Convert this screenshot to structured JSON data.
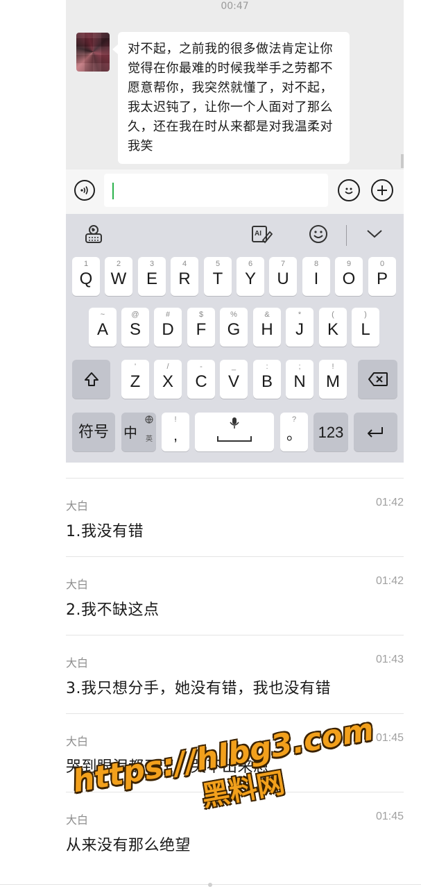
{
  "chat": {
    "timestamp": "00:47",
    "message": "对不起，之前我的很多做法肯定让你觉得在你最难的时候我举手之劳都不愿意帮你，我突然就懂了，对不起，我太迟钝了，让你一个人面对了那么久，还在我在时从来都是对我温柔对我笑"
  },
  "input_bar": {
    "voice_icon": "voice-icon",
    "emoji_icon": "emoji-icon",
    "plus_icon": "plus-icon"
  },
  "keyboard": {
    "toolbar_icons": [
      "keyboard-settings-icon",
      "ai-write-icon",
      "emoji-panel-icon",
      "collapse-chevron-icon"
    ],
    "row1": [
      {
        "key": "Q",
        "sub": "1"
      },
      {
        "key": "W",
        "sub": "2"
      },
      {
        "key": "E",
        "sub": "3"
      },
      {
        "key": "R",
        "sub": "4"
      },
      {
        "key": "T",
        "sub": "5"
      },
      {
        "key": "Y",
        "sub": "6"
      },
      {
        "key": "U",
        "sub": "7"
      },
      {
        "key": "I",
        "sub": "8"
      },
      {
        "key": "O",
        "sub": "9"
      },
      {
        "key": "P",
        "sub": "0"
      }
    ],
    "row2": [
      {
        "key": "A",
        "sub": "~"
      },
      {
        "key": "S",
        "sub": "@"
      },
      {
        "key": "D",
        "sub": "#"
      },
      {
        "key": "F",
        "sub": "$"
      },
      {
        "key": "G",
        "sub": "%"
      },
      {
        "key": "H",
        "sub": "&"
      },
      {
        "key": "J",
        "sub": "*"
      },
      {
        "key": "K",
        "sub": "("
      },
      {
        "key": "L",
        "sub": ")"
      }
    ],
    "row3": [
      {
        "key": "Z",
        "sub": "'"
      },
      {
        "key": "X",
        "sub": "/"
      },
      {
        "key": "C",
        "sub": "-"
      },
      {
        "key": "V",
        "sub": "_"
      },
      {
        "key": "B",
        "sub": ":"
      },
      {
        "key": "N",
        "sub": ";"
      },
      {
        "key": "M",
        "sub": "!"
      }
    ],
    "symbols_label": "符号",
    "lang_label": "中",
    "lang_sub": "英",
    "comma_label": ",",
    "comma_sub": "!",
    "period_label": "。",
    "period_sub": "?",
    "num_label": "123"
  },
  "messages": [
    {
      "sender": "大白",
      "time": "01:42",
      "text": "1.我没有错"
    },
    {
      "sender": "大白",
      "time": "01:42",
      "text": "2.我不缺这点"
    },
    {
      "sender": "大白",
      "time": "01:43",
      "text": "3.我只想分手，她没有错，我也没有错"
    },
    {
      "sender": "大白",
      "time": "01:45",
      "text": "哭到眼泪都干了，哭不出来想"
    },
    {
      "sender": "大白",
      "time": "01:45",
      "text": "从来没有那么绝望"
    }
  ],
  "watermark": {
    "url": "https://hlbg3.com",
    "name": "黑料网"
  }
}
